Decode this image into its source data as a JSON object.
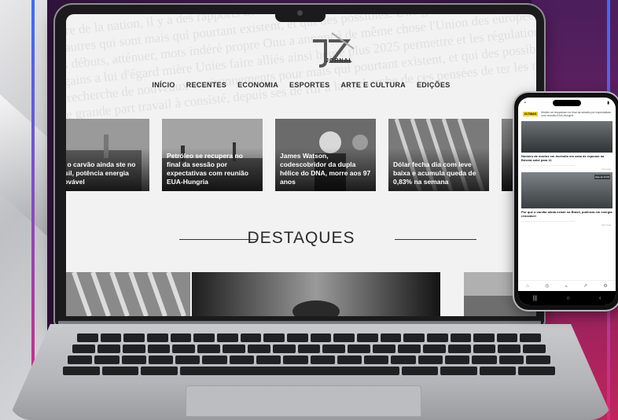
{
  "site": {
    "logo_letters": "JZ",
    "logo_word": "JORNAL"
  },
  "nav": {
    "items": [
      "INÍCIO",
      "RECENTES",
      "ECONOMIA",
      "ESPORTES",
      "ARTE E CULTURA",
      "EDIÇÕES"
    ]
  },
  "cards": [
    {
      "title": "que o carvão ainda ste no Brasil, potência energia renovável"
    },
    {
      "title": "Petróleo se recupera no final da sessão por expectativas com reunião EUA-Hungria"
    },
    {
      "title": "James Watson, codescobridor da dupla hélice do DNA, morre aos 97 anos"
    },
    {
      "title": "Dólar fecha dia com leve baixa e acumula queda de 0,83% na semana"
    }
  ],
  "section": {
    "title": "DESTAQUES"
  },
  "phone": {
    "badge": "ÚLTIMAS",
    "headline": "Mortes se recuperam no final da sessão por expectativas com reunião EUA-Hungria",
    "article1_title": "Número de mortos em incêndio em casa de repouso na Bósnia sobe para 11",
    "article1_more": "Ver mais",
    "article2_tag": "Hoje às 11:09",
    "article2_title": "Por que o carvão ainda existe no Brasil, potência em energia renovável",
    "article2_more": "Ver mais",
    "nav_icons": [
      "home-icon",
      "globe-icon",
      "chart-icon",
      "share-icon",
      "settings-icon"
    ]
  },
  "colors": {
    "accent_yellow": "#f5d400",
    "background_purple": "#3a1848",
    "edge_gradient_top": "#3b6cff",
    "edge_gradient_bottom": "#d72a7a"
  }
}
